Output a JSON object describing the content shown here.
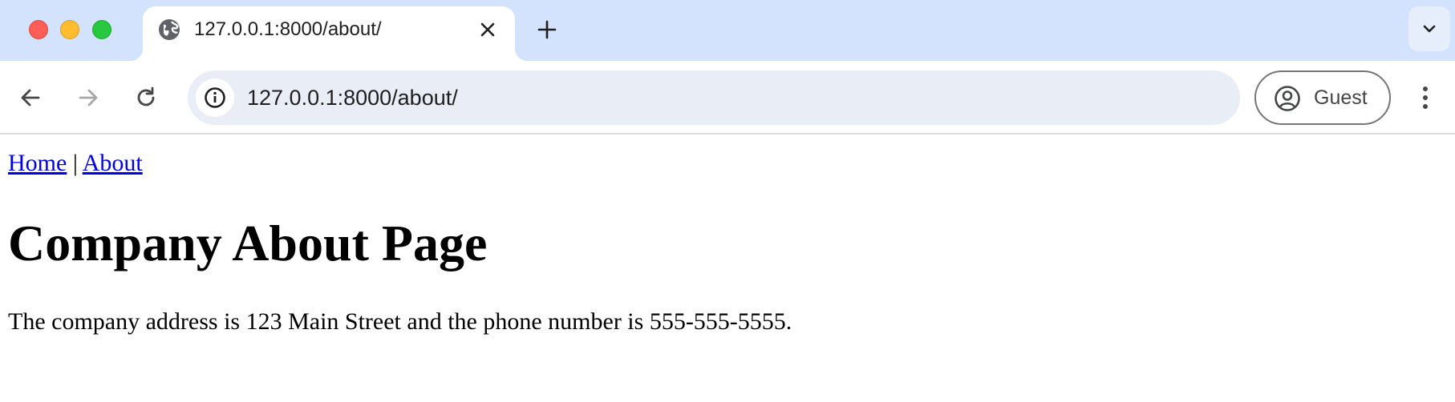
{
  "browser": {
    "tab": {
      "title": "127.0.0.1:8000/about/",
      "favicon": "globe-icon"
    },
    "address_bar": {
      "url": "127.0.0.1:8000/about/",
      "site_info_icon": "info-icon"
    },
    "profile": {
      "label": "Guest",
      "icon": "account-circle-icon"
    },
    "colors": {
      "tabstrip_bg": "#d3e3fd",
      "omnibox_bg": "#e9eef6",
      "close_red": "#ff5f57",
      "minimize_yellow": "#febc2e",
      "zoom_green": "#28c840"
    }
  },
  "page": {
    "nav": {
      "home_label": "Home",
      "separator": "|",
      "about_label": "About"
    },
    "heading": "Company About Page",
    "paragraph": "The company address is 123 Main Street and the phone number is 555-555-5555.",
    "colors": {
      "link": "#0000ee",
      "text": "#000000"
    }
  }
}
